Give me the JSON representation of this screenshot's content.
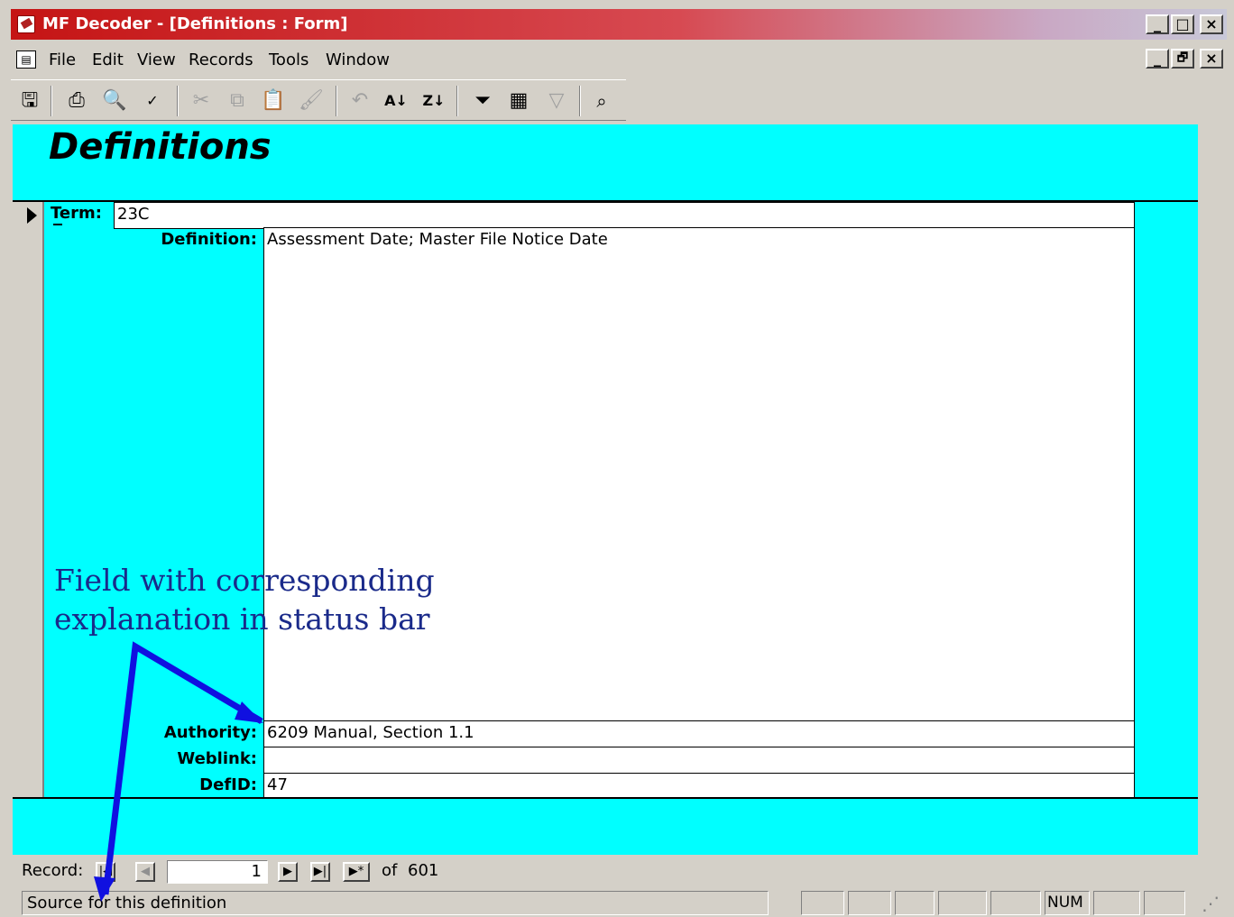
{
  "window": {
    "title": "MF Decoder - [Definitions : Form]"
  },
  "caption_buttons": {
    "minimize": "_",
    "maximize": "□",
    "close": "×",
    "restore": "🗗"
  },
  "menu": {
    "items": [
      "File",
      "Edit",
      "View",
      "Records",
      "Tools",
      "Window"
    ]
  },
  "toolbar": {
    "icons": [
      "save-icon",
      "print-icon",
      "print-preview-icon",
      "spelling-icon",
      "cut-icon",
      "copy-icon",
      "paste-icon",
      "format-painter-icon",
      "undo-icon",
      "sort-ascending-icon",
      "sort-descending-icon",
      "filter-by-selection-icon",
      "filter-by-form-icon",
      "apply-filter-icon",
      "find-icon"
    ]
  },
  "form": {
    "title": "Definitions",
    "background_color": "#00ffff",
    "term": {
      "label": "Term:",
      "value": "23C"
    },
    "definition": {
      "label": "Definition:",
      "value": "Assessment Date; Master File Notice Date"
    },
    "authority": {
      "label": "Authority:",
      "value": "6209 Manual, Section 1.1"
    },
    "weblink": {
      "label": "Weblink:",
      "value": ""
    },
    "defid": {
      "label": "DefID:",
      "value": "47"
    }
  },
  "annotation": {
    "line1": "Field with corresponding",
    "line2": "explanation in status bar",
    "color": "#1a2a8a",
    "arrow_color": "#1010e0"
  },
  "record_nav": {
    "label": "Record:",
    "current": "1",
    "of_label": "of",
    "total": "601"
  },
  "status_bar": {
    "text": "Source for this definition",
    "num": "NUM"
  }
}
